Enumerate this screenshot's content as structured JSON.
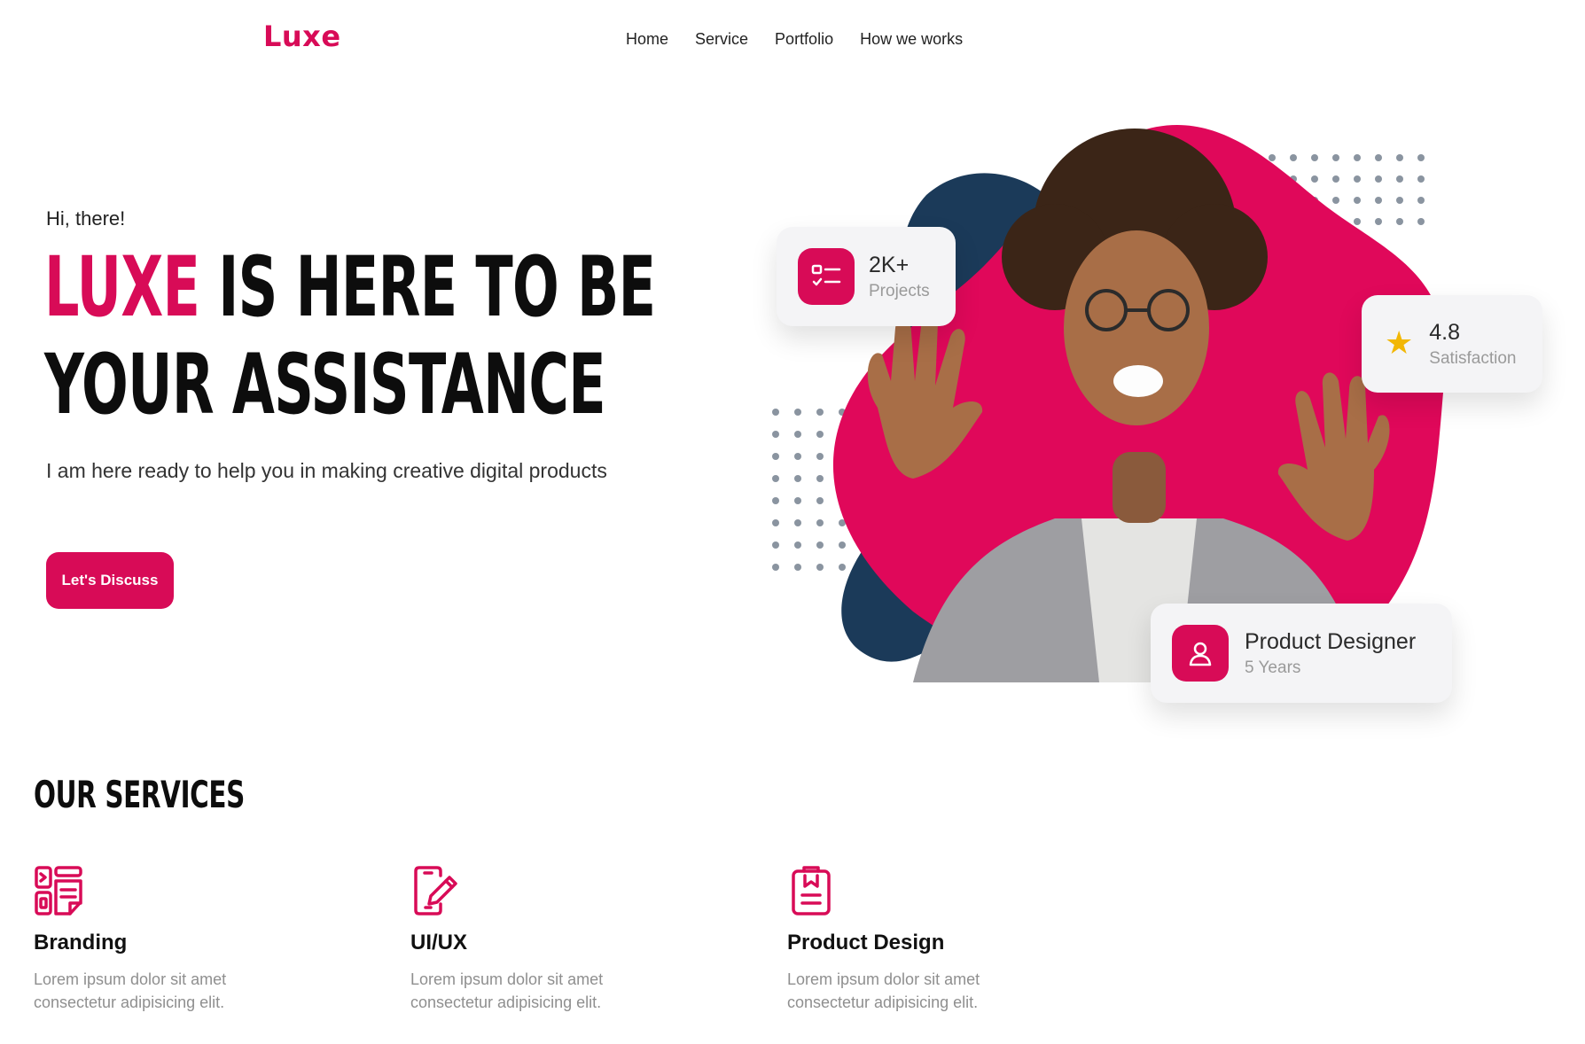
{
  "brand": {
    "logo": "Luxe",
    "accent_color": "#d80b57",
    "navy_color": "#1b3a59"
  },
  "nav": {
    "items": [
      "Home",
      "Service",
      "Portfolio",
      "How we works"
    ]
  },
  "hero": {
    "greeting": "Hi, there!",
    "headline_accent": "LUXE",
    "headline_rest_line1": " IS HERE TO BE",
    "headline_line2": "YOUR ASSISTANCE",
    "subtitle": "I am here ready to help you in making creative digital products",
    "cta_label": "Let's Discuss"
  },
  "stats": {
    "projects": {
      "value": "2K+",
      "label": "Projects",
      "icon": "checklist-icon"
    },
    "rating": {
      "value": "4.8",
      "label": "Satisfaction",
      "icon": "star-icon"
    },
    "role": {
      "value": "Product Designer",
      "label": "5 Years",
      "icon": "user-icon"
    }
  },
  "services": {
    "title": "OUR SERVICES",
    "items": [
      {
        "title": "Branding",
        "desc_line1": "Lorem ipsum dolor sit amet",
        "desc_line2": "consectetur adipisicing elit.",
        "icon": "branding-layout-icon"
      },
      {
        "title": "UI/UX",
        "desc_line1": "Lorem ipsum dolor sit amet",
        "desc_line2": "consectetur adipisicing elit.",
        "icon": "phone-pen-icon"
      },
      {
        "title": "Product Design",
        "desc_line1": "Lorem ipsum dolor sit amet",
        "desc_line2": "consectetur adipisicing elit.",
        "icon": "clipboard-icon"
      }
    ]
  }
}
